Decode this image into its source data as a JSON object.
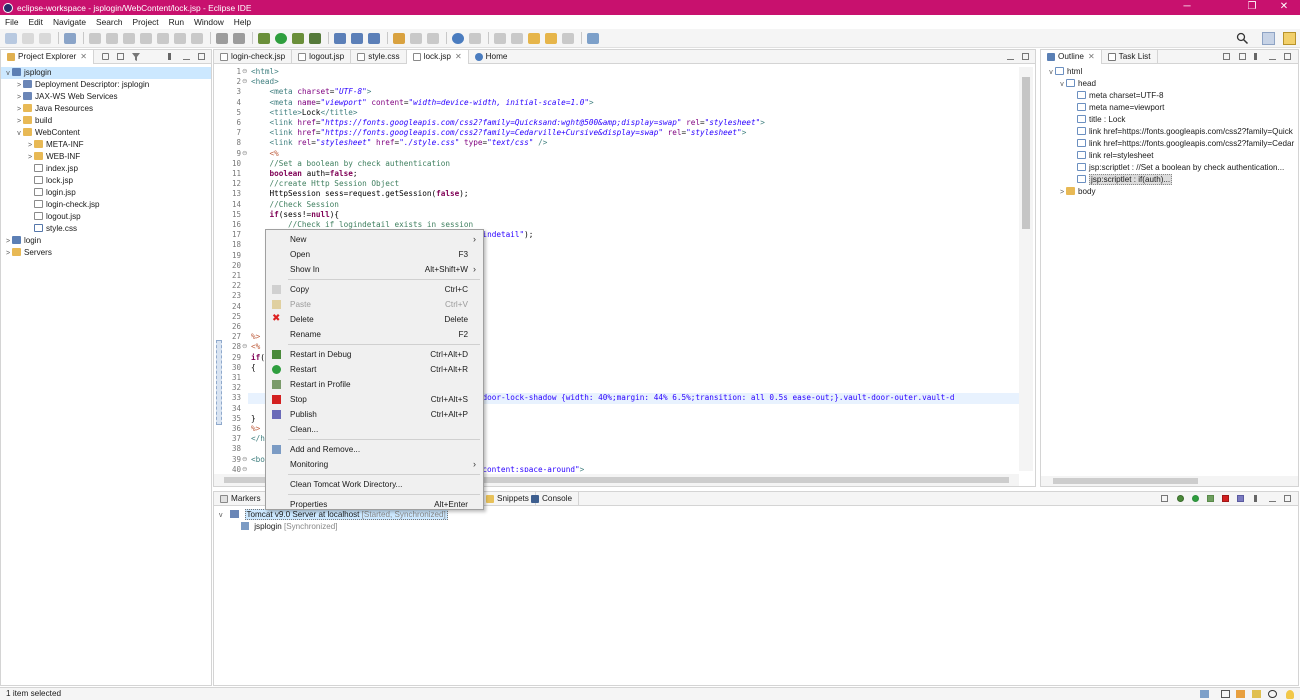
{
  "window": {
    "title": "eclipse-workspace - jsplogin/WebContent/lock.jsp - Eclipse IDE",
    "minimize_glyph": "─",
    "restore_glyph": "❐",
    "close_glyph": "✕"
  },
  "menubar": [
    "File",
    "Edit",
    "Navigate",
    "Search",
    "Project",
    "Run",
    "Window",
    "Help"
  ],
  "project_explorer": {
    "title": "Project Explorer",
    "tree": [
      {
        "label": "jsplogin",
        "indent": 0,
        "twisty": "v",
        "icon": "proj"
      },
      {
        "label": "Deployment Descriptor: jsplogin",
        "indent": 1,
        "twisty": ">",
        "icon": "srv"
      },
      {
        "label": "JAX-WS Web Services",
        "indent": 1,
        "twisty": ">",
        "icon": "srv"
      },
      {
        "label": "Java Resources",
        "indent": 1,
        "twisty": ">",
        "icon": "fold"
      },
      {
        "label": "build",
        "indent": 1,
        "twisty": ">",
        "icon": "fold"
      },
      {
        "label": "WebContent",
        "indent": 1,
        "twisty": "v",
        "icon": "fold"
      },
      {
        "label": "META-INF",
        "indent": 2,
        "twisty": ">",
        "icon": "fold"
      },
      {
        "label": "WEB-INF",
        "indent": 2,
        "twisty": ">",
        "icon": "fold"
      },
      {
        "label": "index.jsp",
        "indent": 2,
        "twisty": "",
        "icon": "jsp"
      },
      {
        "label": "lock.jsp",
        "indent": 2,
        "twisty": "",
        "icon": "jsp"
      },
      {
        "label": "login.jsp",
        "indent": 2,
        "twisty": "",
        "icon": "jsp"
      },
      {
        "label": "login-check.jsp",
        "indent": 2,
        "twisty": "",
        "icon": "jsp"
      },
      {
        "label": "logout.jsp",
        "indent": 2,
        "twisty": "",
        "icon": "jsp"
      },
      {
        "label": "style.css",
        "indent": 2,
        "twisty": "",
        "icon": "css-f"
      },
      {
        "label": "login",
        "indent": 0,
        "twisty": ">",
        "icon": "proj"
      },
      {
        "label": "Servers",
        "indent": 0,
        "twisty": ">",
        "icon": "fold"
      }
    ]
  },
  "editor_tabs": [
    {
      "label": "login-check.jsp",
      "active": false
    },
    {
      "label": "logout.jsp",
      "active": false
    },
    {
      "label": "style.css",
      "active": false
    },
    {
      "label": "lock.jsp",
      "active": true
    },
    {
      "label": "Home",
      "active": false
    }
  ],
  "code_lines": [
    {
      "n": "1",
      "fold": "⊖",
      "html": "<span class='tag'>&lt;html&gt;</span>"
    },
    {
      "n": "2",
      "fold": "⊖",
      "html": "<span class='tag'>&lt;head&gt;</span>"
    },
    {
      "n": "3",
      "fold": "",
      "html": "    <span class='tag'>&lt;meta</span> <span class='attr'>charset</span>=<span class='val'>\"UTF-8\"</span><span class='tag'>&gt;</span>"
    },
    {
      "n": "4",
      "fold": "",
      "html": "    <span class='tag'>&lt;meta</span> <span class='attr'>name</span>=<span class='val'>\"viewport\"</span> <span class='attr'>content</span>=<span class='val'>\"width=device-width, initial-scale=1.0\"</span><span class='tag'>&gt;</span>"
    },
    {
      "n": "5",
      "fold": "",
      "html": "    <span class='tag'>&lt;title&gt;</span><span class='plain'>Lock</span><span class='tag'>&lt;/title&gt;</span>"
    },
    {
      "n": "6",
      "fold": "",
      "html": "    <span class='tag'>&lt;link</span> <span class='attr'>href</span>=<span class='val'>\"https://fonts.googleapis.com/css2?family=Quicksand:wght@500&amp;amp;display=swap\"</span> <span class='attr'>rel</span>=<span class='val'>\"stylesheet\"</span><span class='tag'>&gt;</span>"
    },
    {
      "n": "7",
      "fold": "",
      "html": "    <span class='tag'>&lt;link</span> <span class='attr'>href</span>=<span class='val'>\"https://fonts.googleapis.com/css2?family=Cedarville+Cursive&amp;display=swap\"</span> <span class='attr'>rel</span>=<span class='val'>\"stylesheet\"</span><span class='tag'>&gt;</span>"
    },
    {
      "n": "8",
      "fold": "",
      "html": "    <span class='tag'>&lt;link</span> <span class='attr'>rel</span>=<span class='val'>\"stylesheet\"</span> <span class='attr'>href</span>=<span class='val'>\"./style.css\"</span> <span class='attr'>type</span>=<span class='val'>\"text/css\"</span> <span class='tag'>/&gt;</span>"
    },
    {
      "n": "9",
      "fold": "⊖",
      "html": "    <span class='scr'>&lt;%</span>"
    },
    {
      "n": "10",
      "fold": "",
      "html": "    <span class='com'>//Set a boolean by check authentication</span>"
    },
    {
      "n": "11",
      "fold": "",
      "html": "    <span class='kw'>boolean</span> <span class='plain'>auth=</span><span class='kw'>false</span><span class='plain'>;</span>"
    },
    {
      "n": "12",
      "fold": "",
      "html": "    <span class='com'>//create Http Session Object</span>"
    },
    {
      "n": "13",
      "fold": "",
      "html": "    <span class='plain'>HttpSession sess=request.getSession(</span><span class='kw'>false</span><span class='plain'>);</span>"
    },
    {
      "n": "14",
      "fold": "",
      "html": "    <span class='com'>//Check Session</span>"
    },
    {
      "n": "15",
      "fold": "",
      "html": "    <span class='kw'>if</span><span class='plain'>(sess!=</span><span class='kw'>null</span><span class='plain'>){</span>"
    },
    {
      "n": "16",
      "fold": "",
      "html": "        <span class='com'>//Check if logindetail exists in session</span>"
    },
    {
      "n": "17",
      "fold": "",
      "html": "                                        <span class='plain'>ibute(</span><span class='str'>\"logindetail\"</span><span class='plain'>);</span>"
    },
    {
      "n": "18",
      "fold": "",
      "html": ""
    },
    {
      "n": "19",
      "fold": "",
      "html": ""
    },
    {
      "n": "20",
      "fold": "",
      "html": ""
    },
    {
      "n": "21",
      "fold": "",
      "html": ""
    },
    {
      "n": "22",
      "fold": "",
      "html": ""
    },
    {
      "n": "23",
      "fold": "",
      "html": "    <span class='plain'>}</span>"
    },
    {
      "n": "24",
      "fold": "",
      "html": "    <span class='plain'>}</span>"
    },
    {
      "n": "25",
      "fold": "",
      "html": ""
    },
    {
      "n": "26",
      "fold": "",
      "html": ""
    },
    {
      "n": "27",
      "fold": "",
      "html": "<span class='scr'>%&gt;</span>"
    },
    {
      "n": "28",
      "fold": "⊖",
      "html": "<span class='scr'>&lt;%</span>"
    },
    {
      "n": "29",
      "fold": "",
      "html": "<span class='kw'>if</span><span class='plain'>(au</span>"
    },
    {
      "n": "30",
      "fold": "",
      "html": "<span class='plain'>{</span>"
    },
    {
      "n": "31",
      "fold": "",
      "html": "    <span class='plain'>o</span>"
    },
    {
      "n": "32",
      "fold": "",
      "html": ""
    },
    {
      "n": "33",
      "fold": "",
      "html": "                                       <span class='plain' style='background:#3399ff;color:#fff'>ver</span> <span class='str'>.vault-door-lock-shadow {width: 40%;margin: 44% 6.5%;transition: all 0.5s ease-out;}.vault-door-outer.vault-d</span>"
    },
    {
      "n": "34",
      "fold": "",
      "html": ""
    },
    {
      "n": "35",
      "fold": "",
      "html": "<span class='plain'>}</span>"
    },
    {
      "n": "36",
      "fold": "",
      "html": "<span class='scr'>%&gt;</span>"
    },
    {
      "n": "37",
      "fold": "",
      "html": "<span class='tag'>&lt;/he</span>"
    },
    {
      "n": "38",
      "fold": "",
      "html": ""
    },
    {
      "n": "39",
      "fold": "⊖",
      "html": "<span class='tag'>&lt;body</span>"
    },
    {
      "n": "40",
      "fold": "⊖",
      "html": "                                        <span class='str'>n;justify-content:space-around\"</span><span class='tag'>&gt;</span>"
    }
  ],
  "outline": {
    "tabs": [
      "Outline",
      "Task List"
    ],
    "items": [
      {
        "label": "html",
        "indent": 0,
        "twisty": "v",
        "highlight": false
      },
      {
        "label": "head",
        "indent": 1,
        "twisty": "v",
        "highlight": false
      },
      {
        "label": "meta charset=UTF-8",
        "indent": 2,
        "twisty": "",
        "highlight": false
      },
      {
        "label": "meta name=viewport",
        "indent": 2,
        "twisty": "",
        "highlight": false
      },
      {
        "label": "title : Lock",
        "indent": 2,
        "twisty": "",
        "highlight": false
      },
      {
        "label": "link href=https://fonts.googleapis.com/css2?family=Quick",
        "indent": 2,
        "twisty": "",
        "highlight": false
      },
      {
        "label": "link href=https://fonts.googleapis.com/css2?family=Cedar",
        "indent": 2,
        "twisty": "",
        "highlight": false
      },
      {
        "label": "link rel=stylesheet",
        "indent": 2,
        "twisty": "",
        "highlight": false
      },
      {
        "label": "jsp:scriptlet : //Set a boolean by check authentication...",
        "indent": 2,
        "twisty": "",
        "highlight": false
      },
      {
        "label": "jsp:scriptlet : if(auth)...",
        "indent": 2,
        "twisty": "",
        "highlight": true
      },
      {
        "label": "body",
        "indent": 1,
        "twisty": ">",
        "highlight": false
      }
    ]
  },
  "bottom_tabs": [
    "Markers",
    "Snippets",
    "Console"
  ],
  "servers": {
    "server_name": "Tomcat v9.0 Server at localhost",
    "server_state": "[Started, Synchronized]",
    "module_name": "jsplogin",
    "module_state": "[Synchronized]"
  },
  "context_menu": [
    {
      "type": "item",
      "label": "New",
      "shortcut": "",
      "submenu": true,
      "icon": "",
      "disabled": false
    },
    {
      "type": "item",
      "label": "Open",
      "shortcut": "F3",
      "submenu": false,
      "icon": "",
      "disabled": false
    },
    {
      "type": "item",
      "label": "Show In",
      "shortcut": "Alt+Shift+W",
      "submenu": true,
      "icon": "",
      "disabled": false
    },
    {
      "type": "sep"
    },
    {
      "type": "item",
      "label": "Copy",
      "shortcut": "Ctrl+C",
      "submenu": false,
      "icon": "copy",
      "disabled": false
    },
    {
      "type": "item",
      "label": "Paste",
      "shortcut": "Ctrl+V",
      "submenu": false,
      "icon": "paste",
      "disabled": true
    },
    {
      "type": "item",
      "label": "Delete",
      "shortcut": "Delete",
      "submenu": false,
      "icon": "delete",
      "disabled": false
    },
    {
      "type": "item",
      "label": "Rename",
      "shortcut": "F2",
      "submenu": false,
      "icon": "",
      "disabled": false
    },
    {
      "type": "sep"
    },
    {
      "type": "item",
      "label": "Restart in Debug",
      "shortcut": "Ctrl+Alt+D",
      "submenu": false,
      "icon": "debug",
      "disabled": false
    },
    {
      "type": "item",
      "label": "Restart",
      "shortcut": "Ctrl+Alt+R",
      "submenu": false,
      "icon": "run",
      "disabled": false
    },
    {
      "type": "item",
      "label": "Restart in Profile",
      "shortcut": "",
      "submenu": false,
      "icon": "profile",
      "disabled": false
    },
    {
      "type": "item",
      "label": "Stop",
      "shortcut": "Ctrl+Alt+S",
      "submenu": false,
      "icon": "stop",
      "disabled": false
    },
    {
      "type": "item",
      "label": "Publish",
      "shortcut": "Ctrl+Alt+P",
      "submenu": false,
      "icon": "publish",
      "disabled": false
    },
    {
      "type": "item",
      "label": "Clean...",
      "shortcut": "",
      "submenu": false,
      "icon": "",
      "disabled": false
    },
    {
      "type": "sep"
    },
    {
      "type": "item",
      "label": "Add and Remove...",
      "shortcut": "",
      "submenu": false,
      "icon": "addremove",
      "disabled": false
    },
    {
      "type": "item",
      "label": "Monitoring",
      "shortcut": "",
      "submenu": true,
      "icon": "",
      "disabled": false
    },
    {
      "type": "sep"
    },
    {
      "type": "item",
      "label": "Clean Tomcat Work Directory...",
      "shortcut": "",
      "submenu": false,
      "icon": "",
      "disabled": false
    },
    {
      "type": "sep"
    },
    {
      "type": "item",
      "label": "Properties",
      "shortcut": "Alt+Enter",
      "submenu": false,
      "icon": "",
      "disabled": false
    }
  ],
  "status": {
    "text": "1 item selected"
  },
  "colors": {
    "titlebar": "#c8116e",
    "accent": "#3399ff"
  }
}
